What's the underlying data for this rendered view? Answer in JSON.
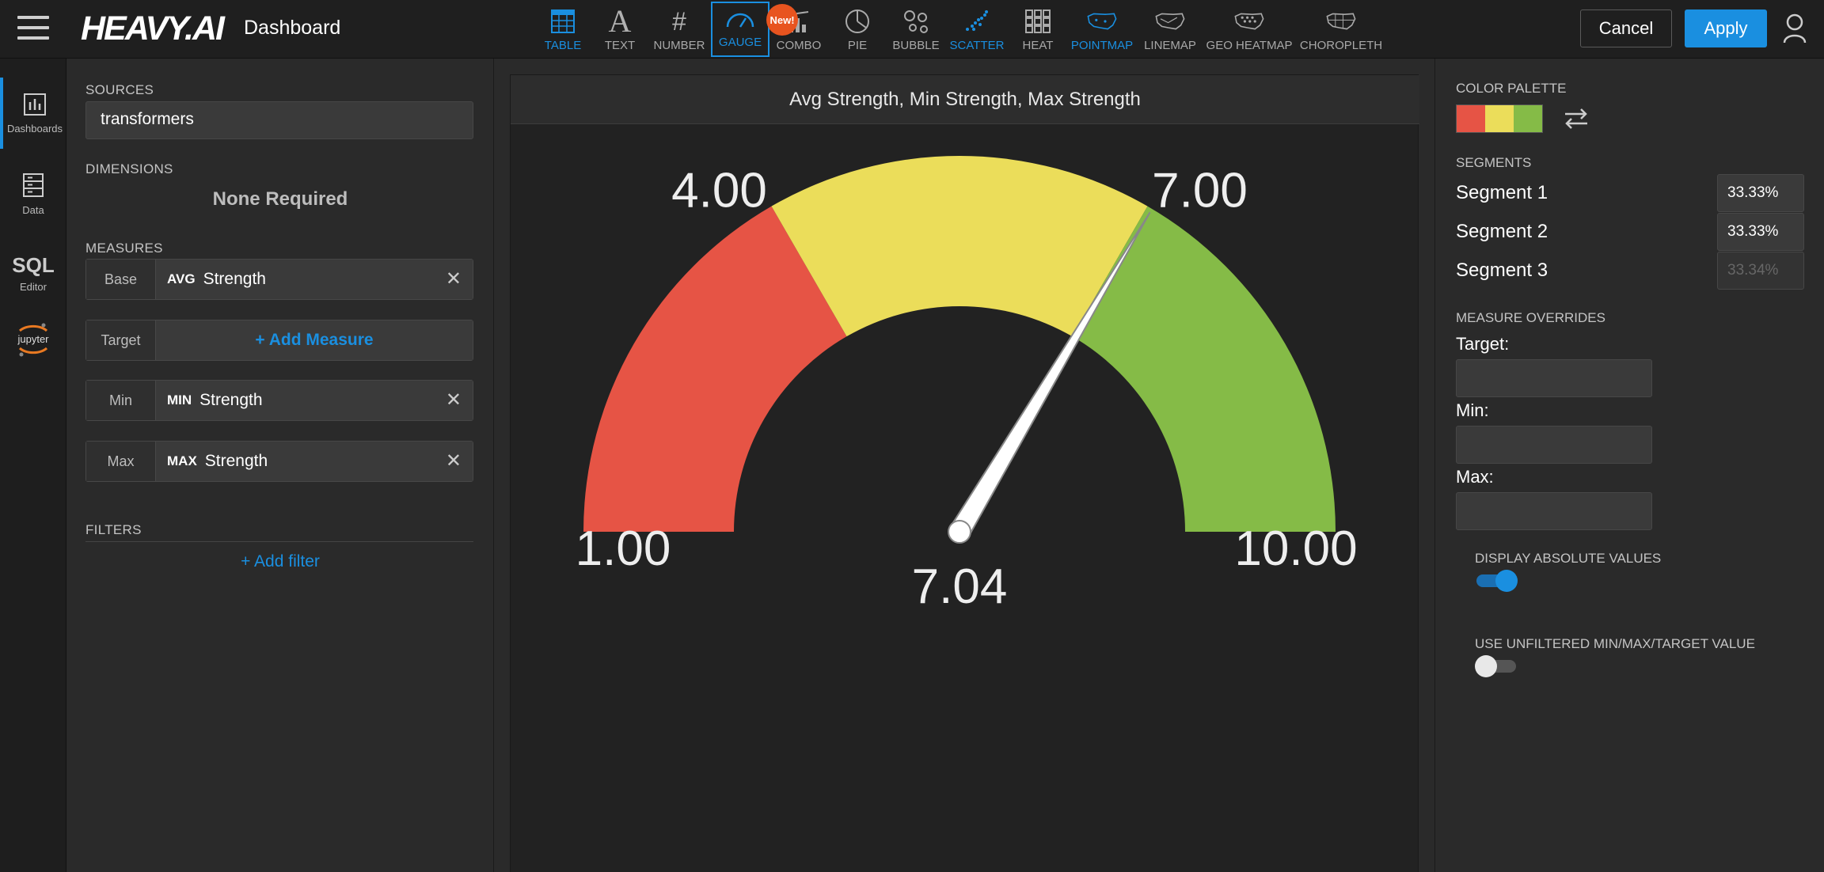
{
  "header": {
    "logo": "HEAVY.AI",
    "title": "Dashboard",
    "cancel_label": "Cancel",
    "apply_label": "Apply",
    "new_badge": "New!"
  },
  "chart_types": [
    {
      "label": "TABLE",
      "icon": "table-icon",
      "state": "blue"
    },
    {
      "label": "TEXT",
      "icon": "text-icon",
      "state": "normal"
    },
    {
      "label": "NUMBER",
      "icon": "number-icon",
      "state": "normal"
    },
    {
      "label": "GAUGE",
      "icon": "gauge-icon",
      "state": "active"
    },
    {
      "label": "COMBO",
      "icon": "combo-icon",
      "state": "normal"
    },
    {
      "label": "PIE",
      "icon": "pie-icon",
      "state": "normal"
    },
    {
      "label": "BUBBLE",
      "icon": "bubble-icon",
      "state": "normal"
    },
    {
      "label": "SCATTER",
      "icon": "scatter-icon",
      "state": "blue"
    },
    {
      "label": "HEAT",
      "icon": "heat-icon",
      "state": "normal"
    },
    {
      "label": "POINTMAP",
      "icon": "pointmap-icon",
      "state": "blue"
    },
    {
      "label": "LINEMAP",
      "icon": "linemap-icon",
      "state": "normal"
    },
    {
      "label": "GEO HEATMAP",
      "icon": "geo-heatmap-icon",
      "state": "normal"
    },
    {
      "label": "CHOROPLETH",
      "icon": "choropleth-icon",
      "state": "normal"
    }
  ],
  "nav": {
    "dashboards": "Dashboards",
    "data": "Data",
    "sql": "SQL",
    "editor": "Editor",
    "jupyter": "jupyter"
  },
  "config": {
    "sources_label": "SOURCES",
    "source": "transformers",
    "dimensions_label": "DIMENSIONS",
    "dimensions_value": "None Required",
    "measures_label": "MEASURES",
    "measures": [
      {
        "role": "Base",
        "agg": "AVG",
        "field": "Strength"
      },
      {
        "role": "Target",
        "add": "+ Add Measure"
      },
      {
        "role": "Min",
        "agg": "MIN",
        "field": "Strength"
      },
      {
        "role": "Max",
        "agg": "MAX",
        "field": "Strength"
      }
    ],
    "filters_label": "FILTERS",
    "add_filter": "+ Add filter"
  },
  "chart_data": {
    "type": "gauge",
    "title": "Avg Strength, Min Strength, Max Strength",
    "min": 1.0,
    "max": 10.0,
    "value": 7.04,
    "min_label": "1.00",
    "max_label": "10.00",
    "value_label": "7.04",
    "thresholds": [
      4.0,
      7.0
    ],
    "threshold_labels": [
      "4.00",
      "7.00"
    ],
    "segment_colors": [
      "#e65445",
      "#ebdd5a",
      "#85bb47"
    ]
  },
  "right": {
    "palette_label": "COLOR PALETTE",
    "palette": [
      "#e65445",
      "#ebdd5a",
      "#85bb47"
    ],
    "segments_label": "SEGMENTS",
    "segments": [
      {
        "name": "Segment 1",
        "value": "33.33%"
      },
      {
        "name": "Segment 2",
        "value": "33.33%"
      },
      {
        "name": "Segment 3",
        "value": "33.34%"
      }
    ],
    "overrides_label": "MEASURE OVERRIDES",
    "overrides": [
      "Target:",
      "Min:",
      "Max:"
    ],
    "toggle_abs_label": "DISPLAY ABSOLUTE VALUES",
    "toggle_abs_on": true,
    "toggle_unf_label": "USE UNFILTERED MIN/MAX/TARGET VALUE",
    "toggle_unf_on": false
  },
  "colors": {
    "accent": "#1a8fe0",
    "badge": "#e8541f"
  }
}
